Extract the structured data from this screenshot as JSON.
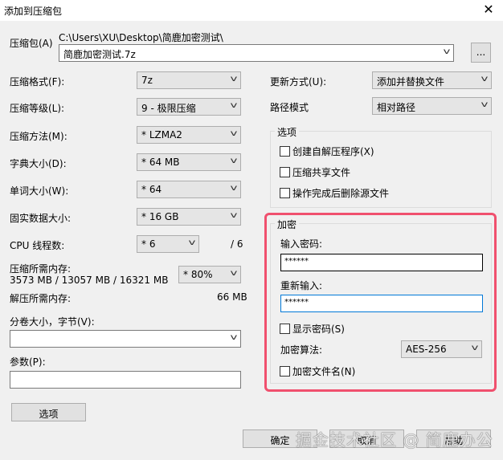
{
  "window": {
    "title": "添加到压缩包",
    "close_icon": "close-icon"
  },
  "archive": {
    "label": "压缩包(A)",
    "path": "C:\\Users\\XU\\Desktop\\简鹿加密测试\\",
    "name": "简鹿加密测试.7z",
    "browse": "..."
  },
  "left": {
    "format": {
      "label": "压缩格式(F):",
      "value": "7z"
    },
    "level": {
      "label": "压缩等级(L):",
      "value": "9 - 极限压缩"
    },
    "method": {
      "label": "压缩方法(M):",
      "value": "* LZMA2"
    },
    "dict": {
      "label": "字典大小(D):",
      "value": "* 64 MB"
    },
    "word": {
      "label": "单词大小(W):",
      "value": "* 64"
    },
    "solid": {
      "label": "固实数据大小:",
      "value": "* 16 GB"
    },
    "cpu": {
      "label": "CPU 线程数:",
      "value": "* 6",
      "max": "/ 6"
    },
    "mem": {
      "label": "压缩所需内存:",
      "detail": "3573 MB / 13057 MB / 16321 MB",
      "value": "* 80%"
    },
    "decomp": {
      "label": "解压所需内存:",
      "value": "66 MB"
    },
    "volume": {
      "label": "分卷大小，字节(V):",
      "value": ""
    },
    "params": {
      "label": "参数(P):",
      "value": ""
    },
    "options_button": "选项"
  },
  "right": {
    "update": {
      "label": "更新方式(U):",
      "value": "添加并替换文件"
    },
    "pathmode": {
      "label": "路径模式",
      "value": "相对路径"
    },
    "options": {
      "title": "选项",
      "items": [
        {
          "label": "创建自解压程序(X)",
          "checked": false
        },
        {
          "label": "压缩共享文件",
          "checked": false
        },
        {
          "label": "操作完成后删除源文件",
          "checked": false
        }
      ]
    },
    "encryption": {
      "title": "加密",
      "pwd_label": "输入密码:",
      "pwd": "******",
      "repeat_label": "重新输入:",
      "repeat": "******",
      "show": "显示密码(S)",
      "algo_label": "加密算法:",
      "algo": "AES-256",
      "encrypt_names": "加密文件名(N)"
    }
  },
  "buttons": {
    "ok": "确定",
    "cancel": "取消",
    "help": "帮助"
  },
  "watermark": "掘金技术社区 @ 简鹿办公",
  "colors": {
    "highlight": "#f0506e",
    "focus": "#0078d7"
  }
}
